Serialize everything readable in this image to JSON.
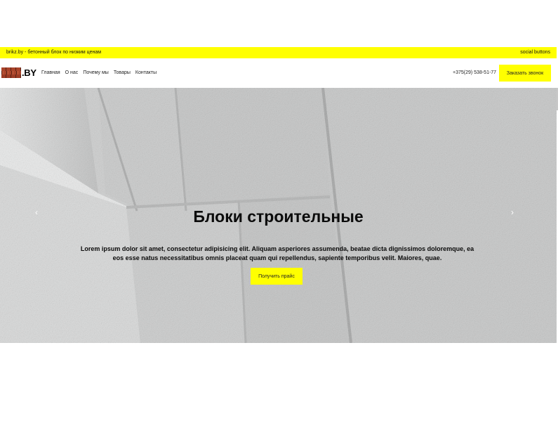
{
  "topbar": {
    "tagline": "brikz.by - бетонный блок по низким ценам",
    "social": "social buttons"
  },
  "header": {
    "logo_text": ".BY",
    "menu": [
      "Главная",
      "О нас",
      "Почему мы",
      "Товары",
      "Контакты"
    ],
    "phone": "+375(29) 538-51-77",
    "call_button": "Заказать звонок"
  },
  "hero": {
    "title": "Блоки строительные",
    "text": "Lorem ipsum dolor sit amet, consectetur adipisicing elit. Aliquam asperiores assumenda, beatae dicta dignissimos doloremque, ea eos esse natus necessitatibus omnis placeat quam qui repellendus, sapiente temporibus velit. Maiores, quae.",
    "button": "Получить прайс",
    "prev_arrow": "‹",
    "next_arrow": "›"
  },
  "colors": {
    "accent": "#ffff00",
    "hero_bg": "#cfd0d0"
  }
}
